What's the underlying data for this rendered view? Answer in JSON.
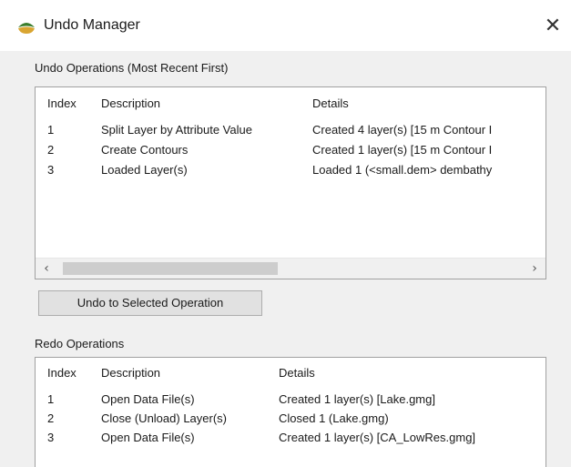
{
  "window": {
    "title": "Undo Manager",
    "close_symbol": "✕",
    "icon": "app-logo-icon"
  },
  "undo": {
    "label": "Undo Operations (Most Recent First)",
    "columns": [
      "Index",
      "Description",
      "Details"
    ],
    "rows": [
      {
        "index": "1",
        "description": "Split Layer by Attribute Value",
        "details": "Created 4 layer(s) [15 m Contour I"
      },
      {
        "index": "2",
        "description": "Create Contours",
        "details": "Created 1 layer(s) [15 m Contour I"
      },
      {
        "index": "3",
        "description": "Loaded Layer(s)",
        "details": "Loaded 1 (<small.dem> dembathy"
      }
    ],
    "scroll_left": "‹",
    "scroll_right": "›",
    "button_label": "Undo to Selected Operation"
  },
  "redo": {
    "label": "Redo Operations",
    "columns": [
      "Index",
      "Description",
      "Details"
    ],
    "rows": [
      {
        "index": "1",
        "description": "Open Data File(s)",
        "details": "Created 1 layer(s) [Lake.gmg]"
      },
      {
        "index": "2",
        "description": "Close (Unload) Layer(s)",
        "details": "Closed 1 (Lake.gmg)"
      },
      {
        "index": "3",
        "description": "Open Data File(s)",
        "details": "Created 1 layer(s) [CA_LowRes.gmg]"
      }
    ]
  }
}
